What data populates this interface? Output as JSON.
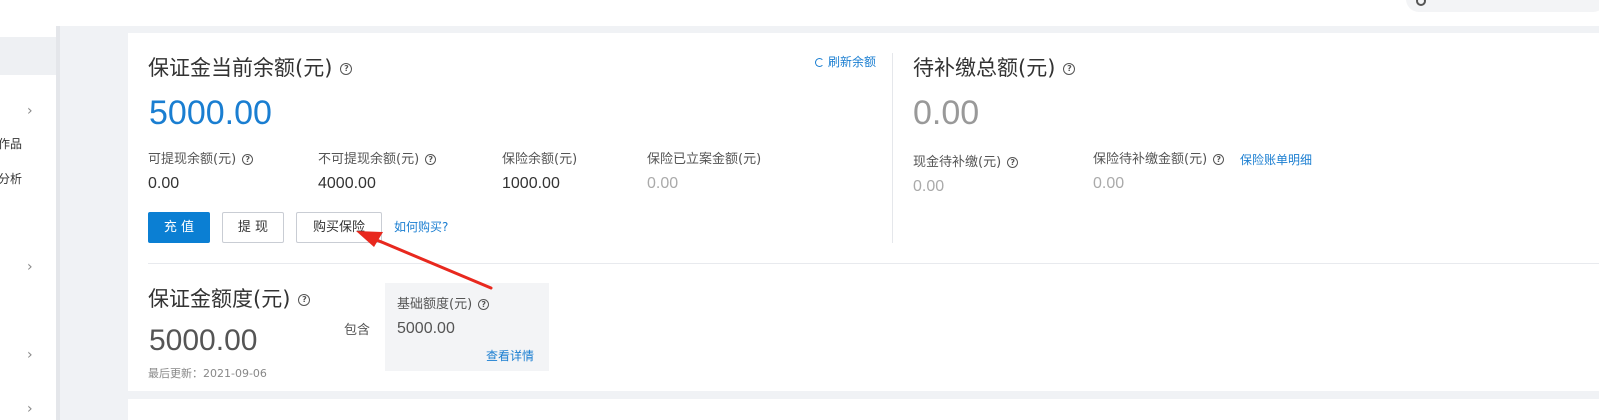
{
  "deposit": {
    "title": "保证金当前余额(元)",
    "refresh_label": "刷新余额",
    "amount": "5000.00",
    "stats": [
      {
        "label": "可提现余额(元)",
        "value": "0.00"
      },
      {
        "label": "不可提现余额(元)",
        "value": "4000.00"
      },
      {
        "label": "保险余额(元)",
        "value": "1000.00"
      },
      {
        "label": "保险已立案金额(元)",
        "value": "0.00"
      }
    ],
    "buttons": {
      "recharge": "充 值",
      "withdraw": "提 现",
      "buy_insurance": "购买保险"
    },
    "how_to_buy": "如何购买?"
  },
  "pending": {
    "title": "待补缴总额(元)",
    "amount": "0.00",
    "stats": [
      {
        "label": "现金待补缴(元)",
        "value": "0.00"
      },
      {
        "label": "保险待补缴金额(元)",
        "value": "0.00"
      }
    ],
    "insurance_detail_link": "保险账单明细"
  },
  "quota": {
    "title": "保证金额度(元)",
    "amount": "5000.00",
    "last_updated": "最后更新：2021-09-06",
    "contains_label": "包含",
    "base_label": "基础额度(元)",
    "base_value": "5000.00",
    "detail_link": "查看详情"
  },
  "sidebar": {
    "items": [
      "作品",
      "分析"
    ]
  },
  "colors": {
    "accent": "#0b7fd3",
    "link": "#1a7ed1",
    "annotation_arrow": "#e8281e"
  },
  "icons": [
    "search-icon",
    "help-icon",
    "refresh-icon",
    "chevron-right-icon",
    "annotation-arrow"
  ]
}
